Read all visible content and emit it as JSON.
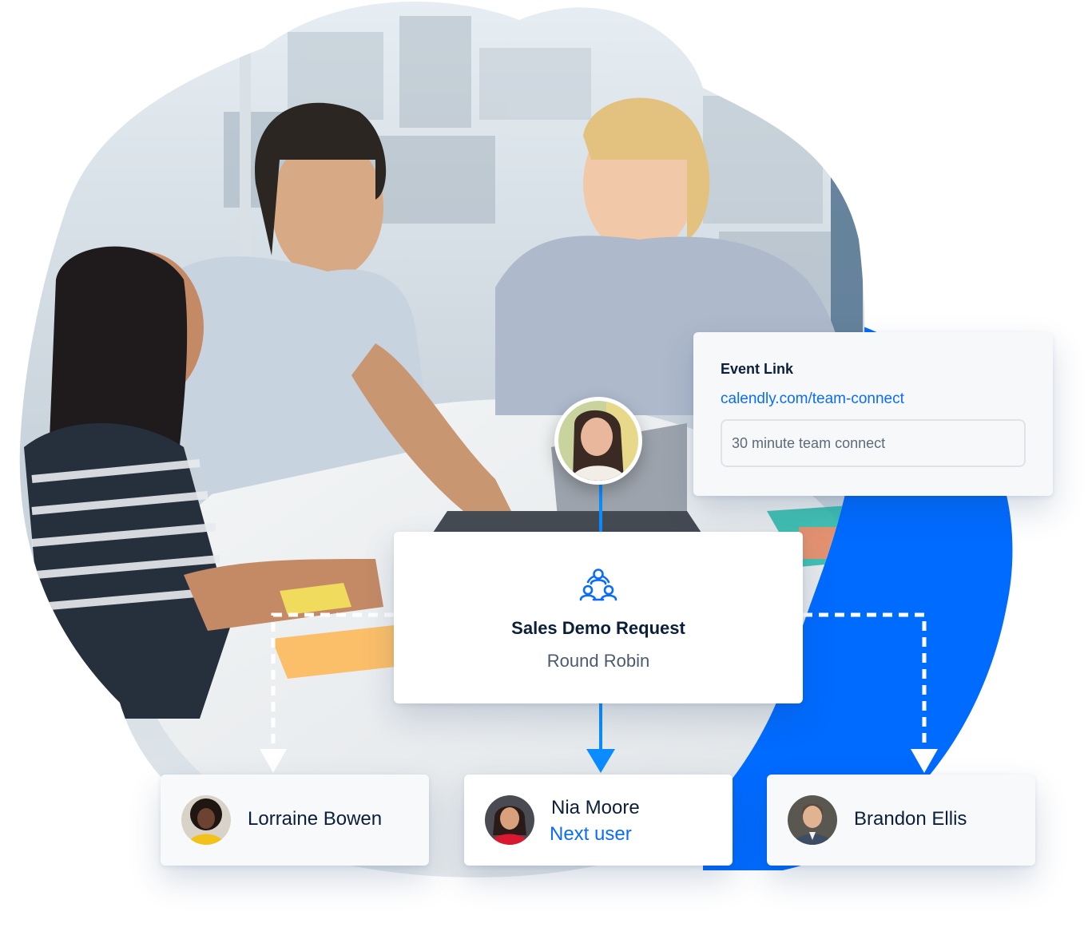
{
  "event_link": {
    "title": "Event Link",
    "url": "calendly.com/team-connect",
    "input_value": "30 minute team connect"
  },
  "routing": {
    "event_name": "Sales Demo Request",
    "distribution": "Round Robin",
    "icon": "team-icon"
  },
  "users": [
    {
      "name": "Lorraine Bowen",
      "status": ""
    },
    {
      "name": "Nia Moore",
      "status": "Next user"
    },
    {
      "name": "Brandon Ellis",
      "status": ""
    }
  ],
  "colors": {
    "accent": "#0a6cff",
    "heading": "#0b1f3a",
    "muted": "#4a5a70"
  }
}
